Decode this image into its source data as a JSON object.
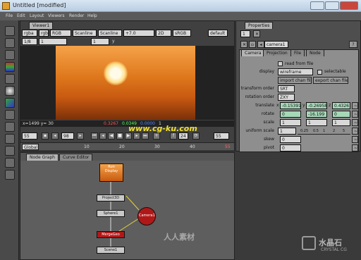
{
  "window": {
    "title": "Untitled [modified]"
  },
  "menu": [
    "File",
    "Edit",
    "Layout",
    "Viewers",
    "Render",
    "Help"
  ],
  "viewer": {
    "tab": "Viewer1",
    "toolbar": {
      "channel": "rgba",
      "input": "rgb",
      "colorspace": "RGB",
      "proxy": "Scanline",
      "scanline": "Scanline",
      "gain": "+7.0",
      "mode": "2D",
      "lut": "sRGB",
      "default": "default",
      "frame_label": "1/8",
      "frame_value": "1",
      "ratio": "1",
      "y_label": "y"
    },
    "info": {
      "coords": "x=1499 y= 30",
      "r": "0.3267",
      "g": "0.0349",
      "b": "0.0000",
      "a": "1"
    },
    "transport": {
      "frame_start": "55",
      "frame": "98",
      "fps": "24",
      "frame_end": "55"
    },
    "timeline": {
      "start": "Global",
      "ticks": [
        "10",
        "20",
        "30",
        "40"
      ],
      "end": "55"
    }
  },
  "nodegraph": {
    "tabs": [
      "Node Graph",
      "Curve Editor"
    ],
    "nodes": [
      {
        "label": "Run\nDisplay"
      },
      {
        "label": "Project3D"
      },
      {
        "label": "Sphere1"
      },
      {
        "label": "Camera1"
      },
      {
        "label": "MergeGeo"
      },
      {
        "label": "Scene1"
      }
    ]
  },
  "properties": {
    "title": "Properties",
    "count": "1",
    "node_name": "camera1",
    "tabs": [
      "Camera",
      "Projection",
      "File",
      "Node"
    ],
    "read_from_file": "read from file",
    "display_label": "display",
    "display_value": "wireframe",
    "selectable": "selectable",
    "import_btn": "import chan file",
    "export_btn": "export chan file",
    "transform_order_label": "transform order",
    "transform_order": "SRT",
    "rotation_order_label": "rotation order",
    "rotation_order": "ZXY",
    "translate_label": "translate",
    "translate": [
      "-0.15391",
      "-0.26958",
      "0.43261"
    ],
    "rotate_label": "rotate",
    "rotate": [
      "0",
      "-16.199",
      "0"
    ],
    "scale_label": "scale",
    "scale": [
      "1",
      "1",
      "1"
    ],
    "uniform_scale_label": "uniform scale",
    "uniform_scale": "1",
    "uniform_ticks": [
      "0.25",
      "0.5",
      "1",
      "2",
      "5"
    ],
    "skew_label": "skew",
    "skew": "0",
    "pivot_label": "pivot",
    "pivot": "0",
    "xyz": [
      "x",
      "y",
      "z"
    ]
  },
  "watermarks": {
    "site": "www.cg-ku.com",
    "cn": "人人素材",
    "logo": "水晶石",
    "logo_sub": "CRYSTAL CG"
  }
}
